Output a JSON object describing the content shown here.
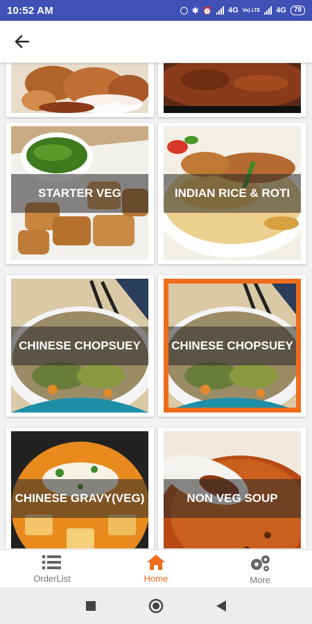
{
  "status_bar": {
    "time": "10:52 AM",
    "network_1": "4G",
    "network_2": "4G",
    "volte": "Vo) LTE",
    "battery": "78"
  },
  "app_bar": {
    "back_icon": "arrow-left-icon"
  },
  "categories": [
    {
      "label": "",
      "image": "fried-chicken"
    },
    {
      "label": "",
      "image": "curry"
    },
    {
      "label": "STARTER VEG",
      "image": "paneer-pakora"
    },
    {
      "label": "INDIAN RICE & ROTI",
      "image": "biryani"
    },
    {
      "label": "CHINESE CHOPSUEY",
      "image": "noodles-bowl"
    },
    {
      "label": "CHINESE CHOPSUEY",
      "image": "noodles-bowl",
      "selected": true
    },
    {
      "label": "CHINESE GRAVY(VEG)",
      "image": "paneer-gravy"
    },
    {
      "label": "NON VEG SOUP",
      "image": "soup"
    }
  ],
  "bottom_nav": {
    "items": [
      {
        "label": "OrderList",
        "icon": "list-icon"
      },
      {
        "label": "Home",
        "icon": "home-icon",
        "active": true
      },
      {
        "label": "More",
        "icon": "gears-icon"
      }
    ]
  },
  "colors": {
    "status_bar": "#3f51b5",
    "accent": "#ef6c1c",
    "inactive": "#757575"
  }
}
